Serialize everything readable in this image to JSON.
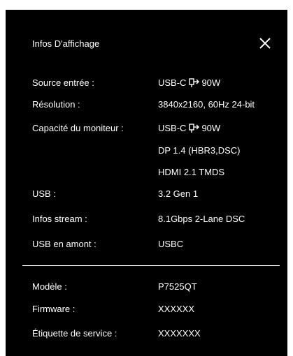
{
  "panel": {
    "title": "Infos D'affichage",
    "close_icon": "close-icon"
  },
  "info": {
    "source": {
      "label": "Source entrée :",
      "value_prefix": "USB-C",
      "value_suffix": "90W"
    },
    "resolution": {
      "label": "Résolution :",
      "value": "3840x2160, 60Hz 24-bit"
    },
    "capability": {
      "label": "Capacité du moniteur :",
      "value_prefix": "USB-C",
      "value_suffix": "90W",
      "value_line2": "DP 1.4 (HBR3,DSC)",
      "value_line3": "HDMI 2.1 TMDS"
    },
    "usb": {
      "label": "USB :",
      "value": "3.2 Gen 1"
    },
    "stream": {
      "label": "Infos stream :",
      "value": "8.1Gbps 2-Lane DSC"
    },
    "upstream": {
      "label": "USB en amont :",
      "value": "USBC"
    }
  },
  "device": {
    "model": {
      "label": "Modèle :",
      "value": "P7525QT"
    },
    "firmware": {
      "label": "Firmware :",
      "value": "XXXXXX"
    },
    "service_tag": {
      "label": "Étiquette de service :",
      "value": "XXXXXXX"
    }
  },
  "colors": {
    "background": "#000000",
    "text": "#ffffff"
  }
}
